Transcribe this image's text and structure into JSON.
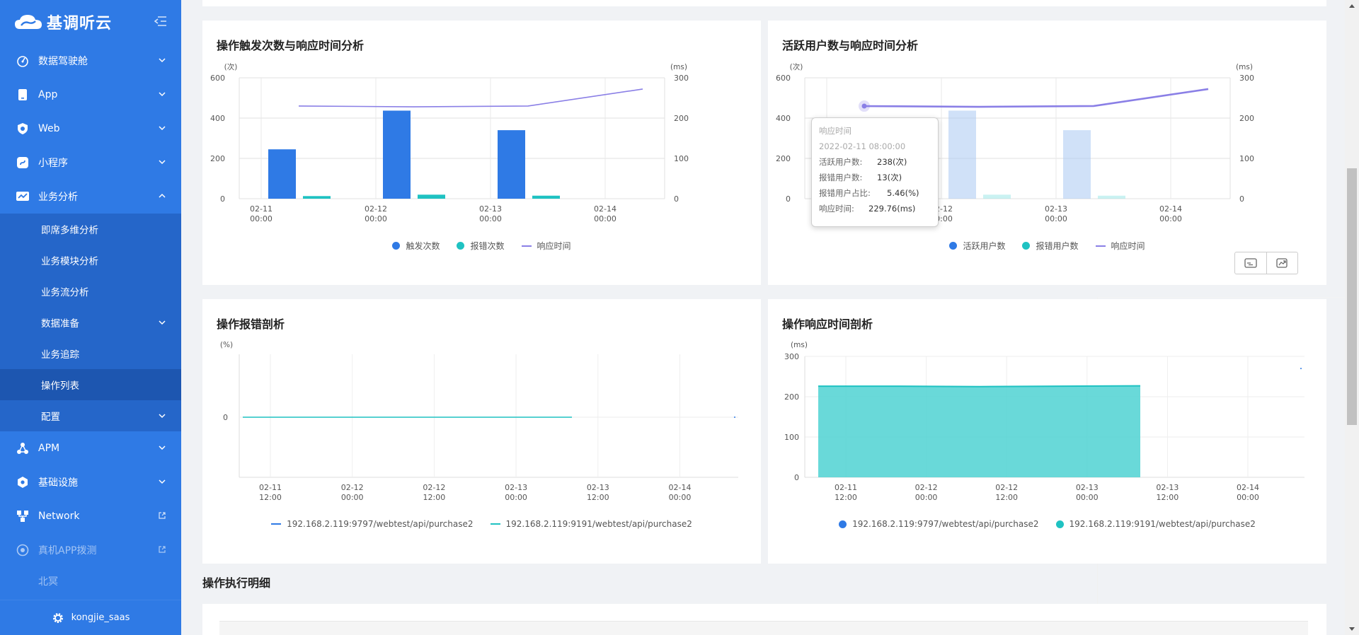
{
  "app": {
    "logo_text": "基调听云",
    "user": "kongjie_saas"
  },
  "sidebar": {
    "items": [
      {
        "label": "数据驾驶舱",
        "icon": "dashboard-icon"
      },
      {
        "label": "App",
        "icon": "app-icon"
      },
      {
        "label": "Web",
        "icon": "web-icon"
      },
      {
        "label": "小程序",
        "icon": "miniprogram-icon"
      },
      {
        "label": "业务分析",
        "icon": "business-analysis-icon"
      }
    ],
    "sub_items": [
      {
        "label": "即席多维分析"
      },
      {
        "label": "业务模块分析"
      },
      {
        "label": "业务流分析"
      },
      {
        "label": "数据准备"
      },
      {
        "label": "业务追踪"
      },
      {
        "label": "操作列表"
      },
      {
        "label": "配置"
      }
    ],
    "bottom_items": [
      {
        "label": "APM",
        "icon": "apm-icon"
      },
      {
        "label": "基础设施",
        "icon": "infra-icon"
      },
      {
        "label": "Network",
        "icon": "network-icon"
      },
      {
        "label": "真机APP拨测",
        "icon": "app-dial-test-icon"
      },
      {
        "label": "北冥"
      }
    ]
  },
  "panels": {
    "p1": {
      "title": "操作触发次数与响应时间分析",
      "legend": [
        "触发次数",
        "报错次数",
        "响应时间"
      ]
    },
    "p2": {
      "title": "活跃用户数与响应时间分析",
      "legend": [
        "活跃用户数",
        "报错用户数",
        "响应时间"
      ],
      "tooltip": {
        "title": "响应时间",
        "time": "2022-02-11 08:00:00",
        "rows": [
          {
            "label": "活跃用户数:",
            "value": "238(次)"
          },
          {
            "label": "报错用户数:",
            "value": "13(次)"
          },
          {
            "label": "报错用户占比:",
            "value": "5.46(%)"
          },
          {
            "label": "响应时间:",
            "value": "229.76(ms)"
          }
        ]
      }
    },
    "p3": {
      "title": "操作报错剖析",
      "legend": [
        "192.168.2.119:9797/webtest/api/purchase2",
        "192.168.2.119:9191/webtest/api/purchase2"
      ]
    },
    "p4": {
      "title": "操作响应时间剖析",
      "legend": [
        "192.168.2.119:9797/webtest/api/purchase2",
        "192.168.2.119:9191/webtest/api/purchase2"
      ]
    }
  },
  "section": {
    "title": "操作执行明细"
  },
  "colors": {
    "sidebar": "#2f7ae5",
    "bar_blue": "#2f7ae5",
    "bar_teal": "#1fc2c2",
    "line_purple": "#8a7fe6",
    "area_teal": "#4fd2d2"
  },
  "chart_data": [
    {
      "type": "bar",
      "title": "操作触发次数与响应时间分析",
      "categories": [
        "02-11 00:00",
        "02-12 00:00",
        "02-13 00:00",
        "02-14 00:00"
      ],
      "y_left_unit": "(次)",
      "y_right_unit": "(ms)",
      "y_left_ticks": [
        0,
        200,
        400,
        600
      ],
      "y_right_ticks": [
        0,
        100,
        200,
        300
      ],
      "ylim": [
        0,
        600
      ],
      "y2lim": [
        0,
        300
      ],
      "series": [
        {
          "name": "触发次数",
          "type": "bar",
          "values": [
            245,
            437,
            340,
            null
          ]
        },
        {
          "name": "报错次数",
          "type": "bar",
          "values": [
            13,
            20,
            15,
            null
          ]
        },
        {
          "name": "响应时间",
          "type": "line",
          "axis": "right",
          "values": [
            230,
            228,
            230,
            272
          ]
        }
      ]
    },
    {
      "type": "bar",
      "title": "活跃用户数与响应时间分析",
      "categories": [
        "02-11 00:00",
        "02-12 00:00",
        "02-13 00:00",
        "02-14 00:00"
      ],
      "y_left_unit": "(次)",
      "y_right_unit": "(ms)",
      "y_left_ticks": [
        0,
        200,
        400,
        600
      ],
      "y_right_ticks": [
        0,
        100,
        200,
        300
      ],
      "ylim": [
        0,
        600
      ],
      "y2lim": [
        0,
        300
      ],
      "series": [
        {
          "name": "活跃用户数",
          "type": "bar",
          "values": [
            238,
            437,
            340,
            null
          ]
        },
        {
          "name": "报错用户数",
          "type": "bar",
          "values": [
            13,
            20,
            15,
            null
          ]
        },
        {
          "name": "响应时间",
          "type": "line",
          "axis": "right",
          "values": [
            229.76,
            228,
            230,
            272
          ]
        }
      ]
    },
    {
      "type": "line",
      "title": "操作报错剖析",
      "y_unit": "(%)",
      "y_ticks": [
        0
      ],
      "x_labels": [
        "02-11 12:00",
        "02-12 00:00",
        "02-12 12:00",
        "02-13 00:00",
        "02-13 12:00",
        "02-14 00:00"
      ],
      "series": [
        {
          "name": "192.168.2.119:9797/webtest/api/purchase2",
          "values": [
            0
          ]
        },
        {
          "name": "192.168.2.119:9191/webtest/api/purchase2",
          "values": [
            0,
            0,
            0,
            0,
            0
          ]
        }
      ]
    },
    {
      "type": "area",
      "title": "操作响应时间剖析",
      "y_unit": "(ms)",
      "y_ticks": [
        0,
        100,
        200,
        300
      ],
      "ylim": [
        0,
        300
      ],
      "x_labels": [
        "02-11 12:00",
        "02-12 00:00",
        "02-12 12:00",
        "02-13 00:00",
        "02-13 12:00",
        "02-14 00:00"
      ],
      "series": [
        {
          "name": "192.168.2.119:9797/webtest/api/purchase2",
          "values": [
            270
          ]
        },
        {
          "name": "192.168.2.119:9191/webtest/api/purchase2",
          "values": [
            226,
            226,
            225,
            226,
            227
          ]
        }
      ]
    }
  ]
}
